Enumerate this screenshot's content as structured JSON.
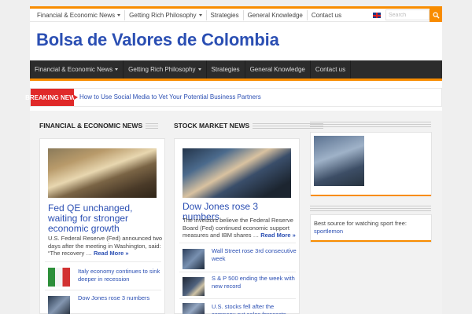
{
  "topbar": {
    "nav": [
      {
        "label": "Financial & Economic News",
        "caret": true
      },
      {
        "label": "Getting Rich Philosophy",
        "caret": true
      },
      {
        "label": "Strategies",
        "caret": false
      },
      {
        "label": "General Knowledge",
        "caret": false
      },
      {
        "label": "Contact us",
        "caret": false
      }
    ],
    "search_placeholder": "Search"
  },
  "site": {
    "title": "Bolsa de Valores de Colombia"
  },
  "mainnav": [
    {
      "label": "Financial & Economic News",
      "caret": true
    },
    {
      "label": "Getting Rich Philosophy",
      "caret": true
    },
    {
      "label": "Strategies",
      "caret": false
    },
    {
      "label": "General Knowledge",
      "caret": false
    },
    {
      "label": "Contact us",
      "caret": false
    }
  ],
  "breaking": {
    "label": "BREAKING NEWS",
    "text": "How to Use Social Media to Vet Your Potential Business Partners"
  },
  "financial": {
    "title": "FINANCIAL & ECONOMIC NEWS",
    "headline": "Fed QE unchanged, waiting for stronger economic growth",
    "excerpt": "U.S. Federal Reserve (Fed) announced two days after the meeting in Washington, said: “The recovery …",
    "more": "Read More »",
    "list": [
      "Italy economy continues to sink deeper in recession",
      "Dow Jones rose 3 numbers"
    ]
  },
  "stock": {
    "title": "STOCK MARKET NEWS",
    "headline": "Dow Jones rose 3 numbers",
    "excerpt": "The investors believe the Federal Reserve Board (Fed) continued economic support measures and IBM shares …",
    "more": "Read More »",
    "list": [
      "Wall Street rose 3rd consecutive week",
      "S & P 500 ending the week with new record",
      "U.S. stocks fell after the company cut sales forecasts"
    ]
  },
  "sidebar": {
    "text": "Best source for watching sport free:",
    "link": "sportlemon"
  },
  "colors": {
    "accent": "#f88c00",
    "link": "#2b4fb3",
    "breaking": "#e02a2a",
    "nav_bg": "#2c2c2c"
  }
}
